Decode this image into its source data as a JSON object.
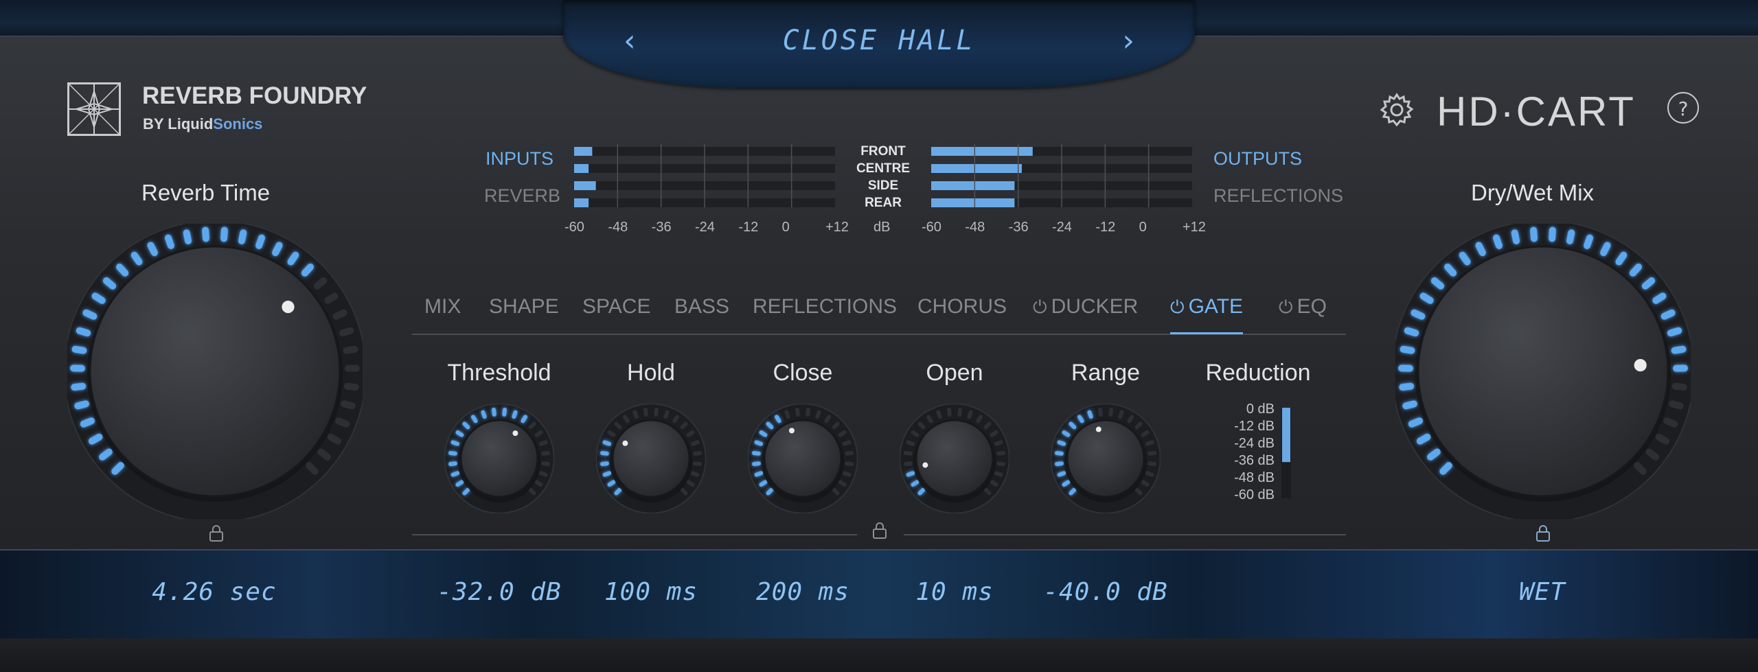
{
  "preset": {
    "name": "CLOSE HALL",
    "prev_icon": "chevron-left-icon",
    "next_icon": "chevron-right-icon"
  },
  "brand": {
    "title": "REVERB FOUNDRY",
    "by": "BY",
    "company_a": "Liquid",
    "company_b": "Sonics",
    "product": "HD·CART",
    "help": "?"
  },
  "left_knob": {
    "label": "Reverb Time",
    "level": 0.68,
    "readout": "4.26 sec"
  },
  "right_knob": {
    "label": "Dry/Wet Mix",
    "level": 0.82,
    "readout": "WET"
  },
  "meters": {
    "inputs_label": "INPUTS",
    "reverb_label": "REVERB",
    "outputs_label": "OUTPUTS",
    "reflections_label": "REFLECTIONS",
    "channels": [
      "FRONT",
      "CENTRE",
      "SIDE",
      "REAR"
    ],
    "unit": "dB",
    "scale": [
      "-60",
      "-48",
      "-36",
      "-24",
      "-12",
      "0",
      "+12"
    ],
    "input_levels": [
      -55,
      -56,
      -54,
      -56
    ],
    "output_levels": [
      -32,
      -35,
      -37,
      -37
    ]
  },
  "tabs": [
    {
      "label": "MIX",
      "power": false,
      "active": false
    },
    {
      "label": "SHAPE",
      "power": false,
      "active": false
    },
    {
      "label": "SPACE",
      "power": false,
      "active": false
    },
    {
      "label": "BASS",
      "power": false,
      "active": false
    },
    {
      "label": "REFLECTIONS",
      "power": false,
      "active": false
    },
    {
      "label": "CHORUS",
      "power": false,
      "active": false
    },
    {
      "label": "DUCKER",
      "power": true,
      "active": false
    },
    {
      "label": "GATE",
      "power": true,
      "active": true
    },
    {
      "label": "EQ",
      "power": true,
      "active": false
    }
  ],
  "gate": {
    "knobs": [
      {
        "label": "Threshold",
        "readout": "-32.0 dB",
        "level": 0.62
      },
      {
        "label": "Hold",
        "readout": "100 ms",
        "level": 0.28
      },
      {
        "label": "Close",
        "readout": "200 ms",
        "level": 0.42
      },
      {
        "label": "Open",
        "readout": "10 ms",
        "level": 0.12
      },
      {
        "label": "Range",
        "readout": "-40.0 dB",
        "level": 0.45
      }
    ],
    "reduction": {
      "label": "Reduction",
      "scale": [
        "0 dB",
        "-12 dB",
        "-24 dB",
        "-36 dB",
        "-48 dB",
        "-60 dB"
      ],
      "level_db": -36
    }
  },
  "colors": {
    "accent": "#6fb2f0",
    "led": "#5ea8ee",
    "meter_fill": "#6aa9e6"
  }
}
